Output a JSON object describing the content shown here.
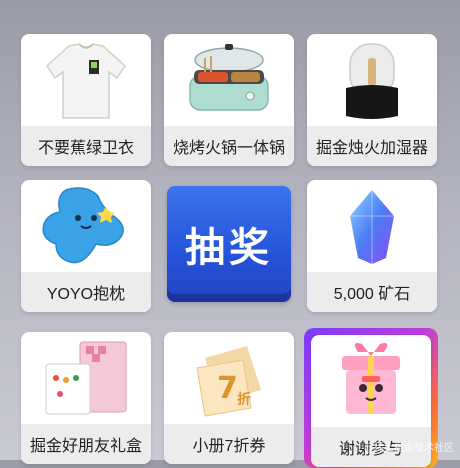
{
  "prizes": [
    {
      "label": "不要蕉绿卫衣",
      "icon": "sweater-icon"
    },
    {
      "label": "烧烤火锅一体锅",
      "icon": "hotpot-grill-icon"
    },
    {
      "label": "掘金烛火加湿器",
      "icon": "humidifier-icon"
    },
    {
      "label": "YOYO抱枕",
      "icon": "pillow-icon"
    },
    {
      "label": "5,000 矿石",
      "icon": "ore-crystal-icon"
    },
    {
      "label": "掘金好朋友礼盒",
      "icon": "gift-card-box-icon"
    },
    {
      "label": "小册7折券",
      "icon": "coupon-icon"
    },
    {
      "label": "谢谢参与",
      "icon": "gift-box-icon"
    }
  ],
  "draw_button": {
    "label": "抽奖"
  },
  "coupon_badge": {
    "digit": "7",
    "unit": "折"
  },
  "watermark": "@稀土掘金技术社区",
  "colors": {
    "accent_blue": "#2553d8",
    "highlight_gradient_start": "#7a3cff",
    "highlight_gradient_end": "#ffb21f"
  }
}
